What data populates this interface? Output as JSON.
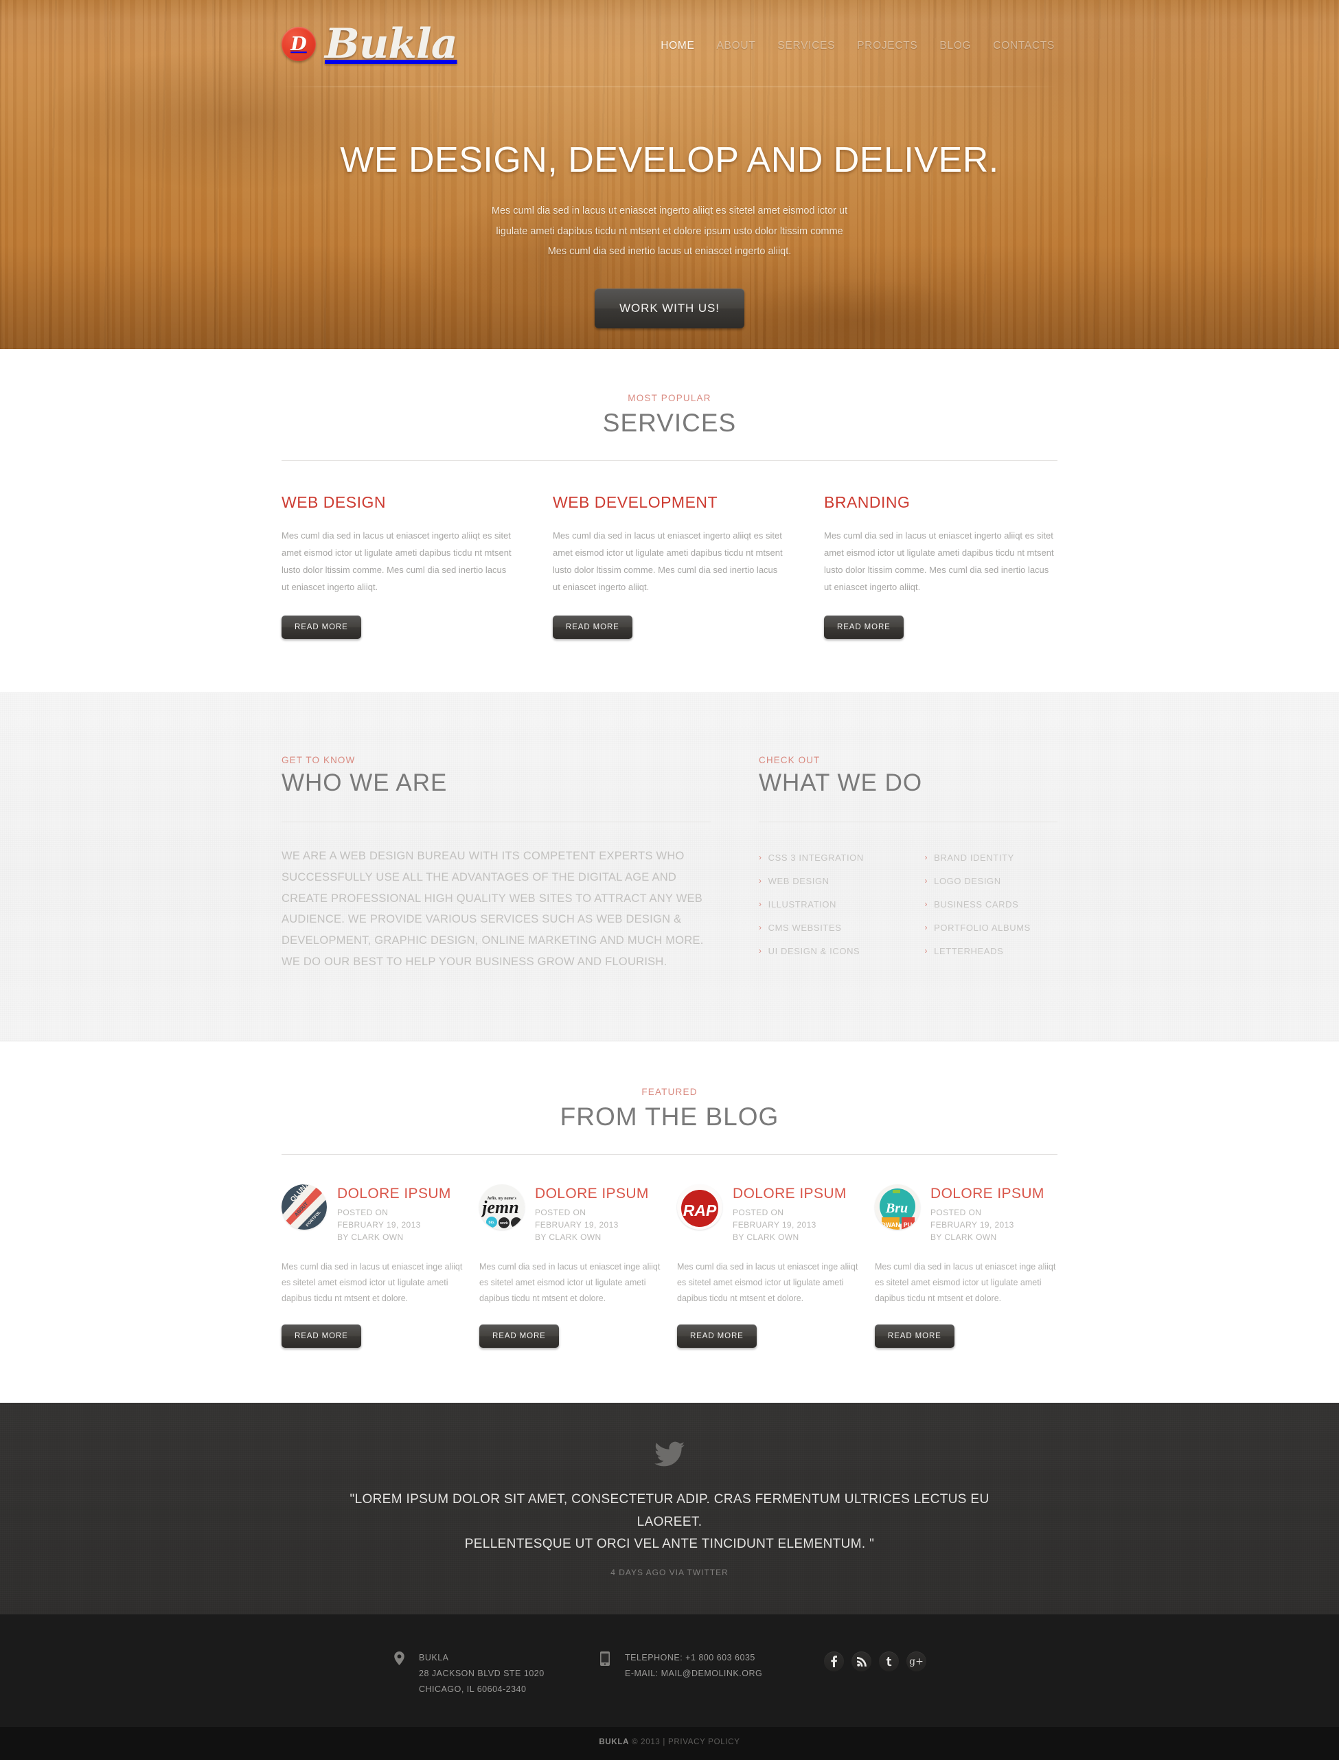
{
  "brand": {
    "badge_letter": "D",
    "name": "Bukla"
  },
  "nav": {
    "items": [
      {
        "label": "HOME",
        "active": true
      },
      {
        "label": "ABOUT",
        "active": false
      },
      {
        "label": "SERVICES",
        "active": false
      },
      {
        "label": "PROJECTS",
        "active": false
      },
      {
        "label": "BLOG",
        "active": false
      },
      {
        "label": "CONTACTS",
        "active": false
      }
    ]
  },
  "hero": {
    "title": "WE DESIGN, DEVELOP AND DELIVER.",
    "sub_line1": "Mes cuml dia sed in lacus ut eniascet ingerto aliiqt es sitetel amet eismod ictor ut",
    "sub_line2": "ligulate ameti dapibus ticdu nt mtsent et  dolore ipsum usto dolor ltissim comme",
    "sub_line3": "Mes cuml dia sed inertio lacus ut eniascet ingerto aliiqt.",
    "cta_label": "WORK WITH US!"
  },
  "services": {
    "kicker": "MOST POPULAR",
    "title": "SERVICES",
    "read_more_label": "READ MORE",
    "columns": [
      {
        "title": "WEB DESIGN",
        "body": "Mes cuml dia sed in lacus ut eniascet ingerto aliiqt es sitet amet eismod ictor ut ligulate ameti dapibus ticdu nt mtsent lusto dolor ltissim comme. Mes cuml dia sed inertio lacus ut eniascet ingerto aliiqt."
      },
      {
        "title": "WEB DEVELOPMENT",
        "body": "Mes cuml dia sed in lacus ut eniascet ingerto aliiqt es sitet amet eismod ictor ut ligulate ameti dapibus ticdu nt mtsent lusto dolor ltissim comme. Mes cuml dia sed inertio lacus ut eniascet ingerto aliiqt."
      },
      {
        "title": "BRANDING",
        "body": "Mes cuml dia sed in lacus ut eniascet ingerto aliiqt es sitet amet eismod ictor ut ligulate ameti dapibus ticdu nt mtsent lusto dolor ltissim comme. Mes cuml dia sed inertio lacus ut eniascet ingerto aliiqt."
      }
    ]
  },
  "who_we_are": {
    "kicker": "GET TO KNOW",
    "title": "WHO WE ARE",
    "body": "WE ARE A WEB DESIGN BUREAU WITH ITS COMPETENT EXPERTS WHO SUCCESSFULLY USE ALL THE ADVANTAGES OF THE DIGITAL AGE AND CREATE PROFESSIONAL HIGH QUALITY WEB SITES TO ATTRACT ANY WEB AUDIENCE. WE PROVIDE VARIOUS SERVICES SUCH AS WEB DESIGN & DEVELOPMENT, GRAPHIC DESIGN, ONLINE MARKETING AND MUCH MORE. WE DO OUR BEST TO HELP YOUR BUSINESS GROW AND FLOURISH."
  },
  "what_we_do": {
    "kicker": "CHECK OUT",
    "title": "WHAT WE DO",
    "col1": [
      "CSS 3 INTEGRATION",
      "WEB DESIGN",
      "ILLUSTRATION",
      "CMS WEBSITES",
      "UI DESIGN & ICONS"
    ],
    "col2": [
      "BRAND IDENTITY",
      "LOGO DESIGN",
      "BUSINESS CARDS",
      "PORTFOLIO ALBUMS",
      "LETTERHEADS"
    ]
  },
  "blog": {
    "kicker": "FEATURED",
    "title": "FROM THE BLOG",
    "read_more_label": "READ MORE",
    "posts": [
      {
        "title": "DOLORE IPSUM",
        "posted_label": "POSTED ON",
        "date": "FEBRUARY 19, 2013",
        "author": "BY CLARK OWN",
        "excerpt": "Mes cuml dia sed in lacus ut eniascet inge aliiqt es sitetel amet eismod ictor ut ligulate ameti dapibus ticdu nt mtsent et dolore.",
        "thumb_name": "qlunx-portfolio-thumb",
        "thumb_text": "QLUNX"
      },
      {
        "title": "DOLORE IPSUM",
        "posted_label": "POSTED ON",
        "date": "FEBRUARY 19, 2013",
        "author": "BY CLARK OWN",
        "excerpt": "Mes cuml dia sed in lacus ut eniascet inge aliiqt es sitetel amet eismod ictor ut ligulate ameti dapibus ticdu nt mtsent et dolore.",
        "thumb_name": "jemn-hello-thumb",
        "thumb_text": "jemn"
      },
      {
        "title": "DOLORE IPSUM",
        "posted_label": "POSTED ON",
        "date": "FEBRUARY 19, 2013",
        "author": "BY CLARK OWN",
        "excerpt": "Mes cuml dia sed in lacus ut eniascet inge aliiqt es sitetel amet eismod ictor ut ligulate ameti dapibus ticdu nt mtsent et dolore.",
        "thumb_name": "rap-thumb",
        "thumb_text": "RAP"
      },
      {
        "title": "DOLORE IPSUM",
        "posted_label": "POSTED ON",
        "date": "FEBRUARY 19, 2013",
        "author": "BY CLARK OWN",
        "excerpt": "Mes cuml dia sed in lacus ut eniascet inge aliiqt es sitetel amet eismod ictor ut ligulate ameti dapibus ticdu nt mtsent et dolore.",
        "thumb_name": "bru-dwan-thumb",
        "thumb_text": "Bru"
      }
    ]
  },
  "twitter": {
    "icon": "twitter-bird-icon",
    "quote_line1": "\"LOREM IPSUM DOLOR SIT AMET, CONSECTETUR ADIP. CRAS FERMENTUM ULTRICES LECTUS EU LAOREET.",
    "quote_line2": "PELLENTESQUE UT ORCI VEL ANTE TINCIDUNT ELEMENTUM.  \"",
    "ago": "4 DAYS AGO VIA TWITTER"
  },
  "footer": {
    "address": {
      "icon": "map-pin-icon",
      "line1": "BUKLA",
      "line2": "28 JACKSON BLVD STE 1020",
      "line3": "CHICAGO, IL 60604-2340"
    },
    "contact": {
      "icon": "mobile-phone-icon",
      "line1": "TELEPHONE: +1 800 603 6035",
      "line2": "E-MAIL: MAIL@DEMOLINK.ORG"
    },
    "socials": [
      {
        "name": "facebook",
        "glyph": "f"
      },
      {
        "name": "rss",
        "glyph": "✈"
      },
      {
        "name": "twitter",
        "glyph": "t"
      },
      {
        "name": "google-plus",
        "glyph": "g+"
      }
    ],
    "copyright_brand": "BUKLA",
    "copyright_rest": "© 2013  |  PRIVACY POLICY"
  },
  "colors": {
    "accent_red": "#cd3c32",
    "kicker_pink": "#d98a80",
    "heading_gray": "#7a7a7a",
    "wood": "#c0813f",
    "dark_panel": "#302f2e",
    "footer": "#1b1b1b"
  }
}
